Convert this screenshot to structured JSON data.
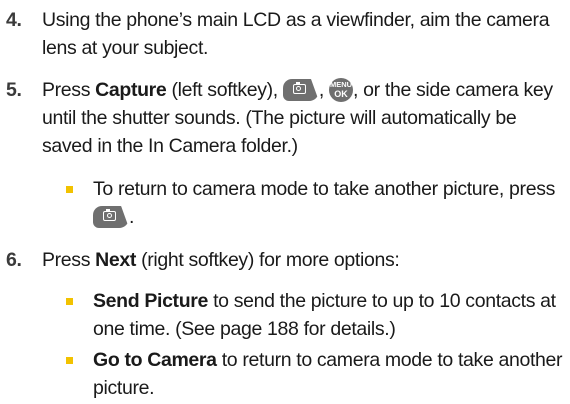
{
  "steps": [
    {
      "number": "4.",
      "text": "Using the phone’s main LCD as a viewfinder, aim the camera lens at your subject."
    },
    {
      "number": "5.",
      "pre": "Press ",
      "bold": "Capture",
      "mid": " (left softkey), ",
      "sep": ", ",
      "post": ", or the side camera key until the shutter sounds. (The picture will automatically be saved in the In Camera folder.)",
      "bullet": {
        "pre": "To return to camera mode to take another picture, press ",
        "post": "."
      }
    },
    {
      "number": "6.",
      "pre": "Press ",
      "bold": "Next",
      "post": " (right softkey) for more options:",
      "bullets": [
        {
          "bold": "Send Picture",
          "text": " to send the picture to up to 10 contacts at one time. (See page 188 for details.)"
        },
        {
          "bold": "Go to Camera",
          "text": " to return to camera mode to take another picture."
        }
      ]
    }
  ],
  "keys": {
    "camera": {
      "icon": "camera-key-icon"
    },
    "menu_ok": {
      "icon": "menu-ok-key-icon",
      "top": "MENU",
      "bottom": "OK"
    }
  },
  "colors": {
    "bullet": "#f2c200",
    "key": "#6f6f6f",
    "text": "#1a1a1a"
  }
}
